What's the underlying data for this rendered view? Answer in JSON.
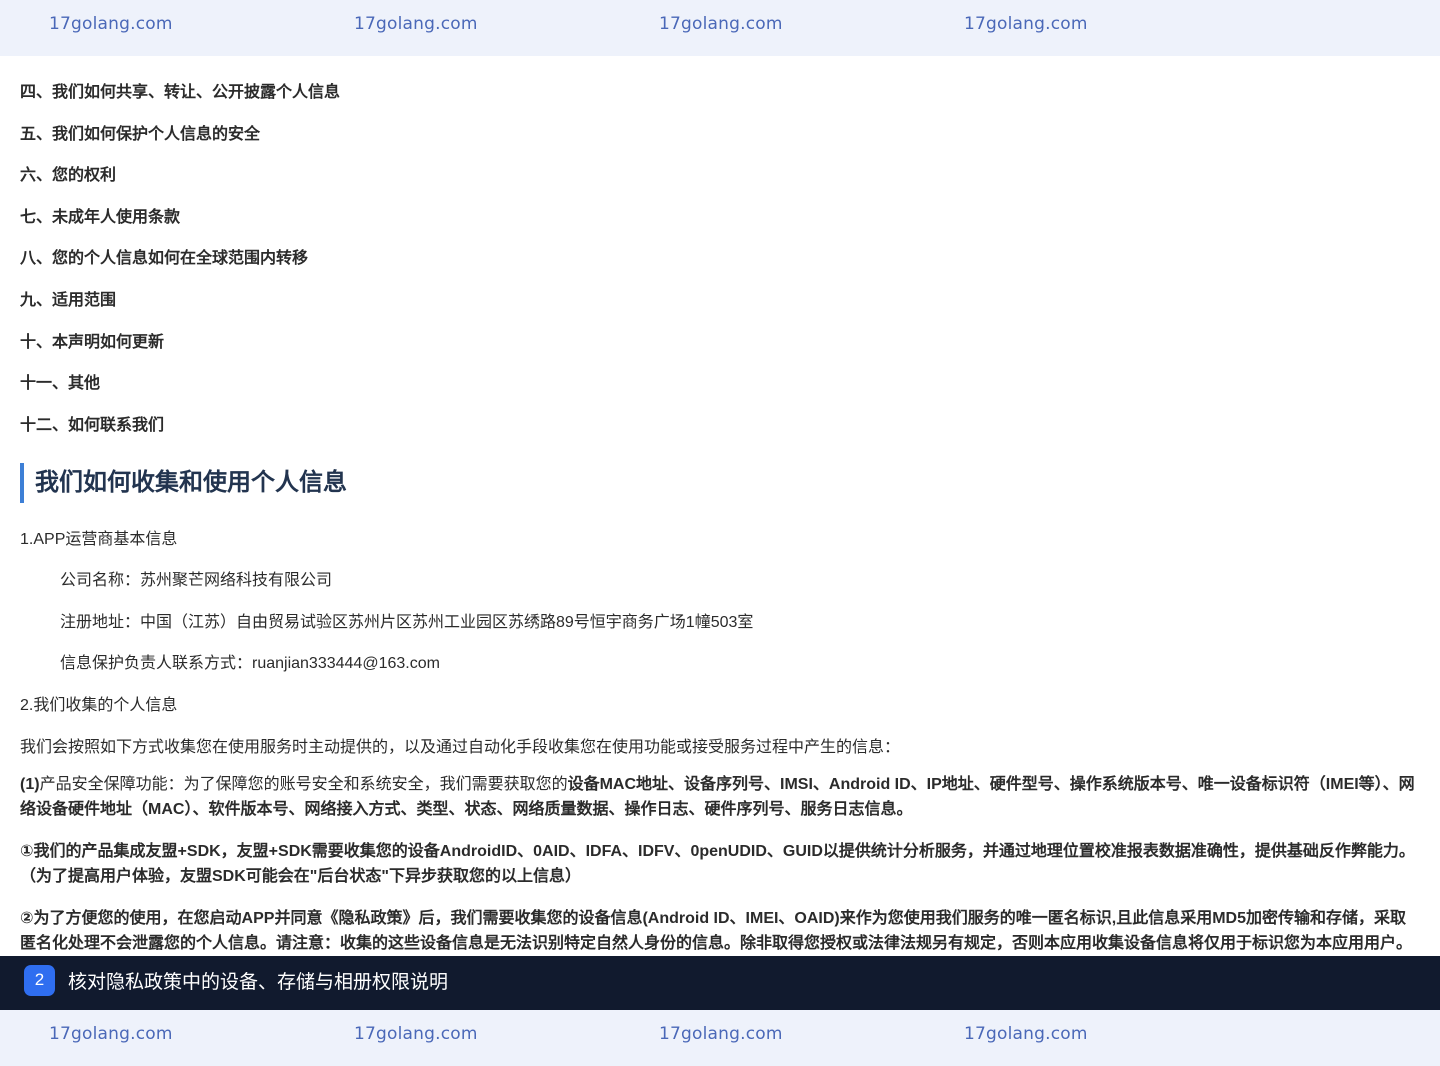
{
  "watermark": {
    "text_1": "17golang.com",
    "text_2": "17golang.com",
    "text_3": "17golang.com",
    "text_4": "17golang.com"
  },
  "toc": [
    "四、我们如何共享、转让、公开披露个人信息",
    "五、我们如何保护个人信息的安全",
    "六、您的权利",
    "七、未成年人使用条款",
    "八、您的个人信息如何在全球范围内转移",
    "九、适用范围",
    "十、本声明如何更新",
    "十一、其他",
    "十二、如何联系我们"
  ],
  "section": {
    "title": "我们如何收集和使用个人信息",
    "item1_title": "1.APP运营商基本信息",
    "company_name": "公司名称：苏州聚芒网络科技有限公司",
    "address": "注册地址：中国（江苏）自由贸易试验区苏州片区苏州工业园区苏绣路89号恒宇商务广场1幢503室",
    "contact": "信息保护负责人联系方式：ruanjian333444@163.com",
    "item2_title": "2.我们收集的个人信息",
    "intro": "我们会按照如下方式收集您在使用服务时主动提供的，以及通过自动化手段收集您在使用功能或接受服务过程中产生的信息：",
    "para1_lead": "(1)",
    "para1_normal": "产品安全保障功能：为了保障您的账号安全和系统安全，我们需要获取您的",
    "para1_bold": "设备MAC地址、设备序列号、IMSI、Android ID、IP地址、硬件型号、操作系统版本号、唯一设备标识符（IMEI等）、网络设备硬件地址（MAC）、软件版本号、网络接入方式、类型、状态、网络质量数据、操作日志、硬件序列号、服务日志信息。",
    "para2": "①我们的产品集成友盟+SDK，友盟+SDK需要收集您的设备AndroidID、0AID、IDFA、IDFV、0penUDID、GUID以提供统计分析服务，并通过地理位置校准报表数据准确性，提供基础反作弊能力。（为了提高用户体验，友盟SDK可能会在\"后台状态\"下异步获取您的以上信息）",
    "para3": "②为了方便您的使用，在您启动APP并同意《隐私政策》后，我们需要收集您的设备信息(Android ID、IMEI、OAID)来作为您使用我们服务的唯一匿名标识,且此信息采用MD5加密传输和存储，采取匿名化处理不会泄露您的个人信息。请注意：收集的这些设备信息是无法识别特定自然人身份的信息。除非取得您授权或法律法规另有规定，否则本应用收集设备信息将仅用于标识您为本应用用户。"
  },
  "banner": {
    "step": "2",
    "text": "核对隐私政策中的设备、存储与相册权限说明"
  }
}
